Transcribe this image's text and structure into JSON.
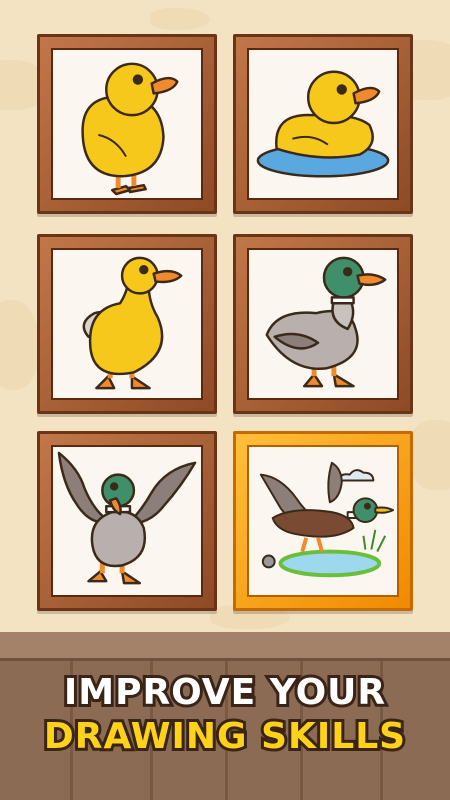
{
  "caption": {
    "line1": "IMPROVE YOUR",
    "line2": "DRAWING SKILLS"
  },
  "levels": [
    {
      "icon": "yellow-duckling-icon"
    },
    {
      "icon": "floating-rubber-duck-icon"
    },
    {
      "icon": "yellow-duck-standing-icon"
    },
    {
      "icon": "mallard-duck-icon"
    },
    {
      "icon": "flying-mallard-duck-icon"
    },
    {
      "icon": "mallard-landing-pond-icon",
      "selected": true
    }
  ],
  "colors": {
    "frame": "#a65d30",
    "frame_selected": "#f5a21c",
    "caption_line1": "#ffffff",
    "caption_line2": "#ffd21a",
    "wall": "#f4e3c3",
    "floor": "#8c6b54"
  }
}
